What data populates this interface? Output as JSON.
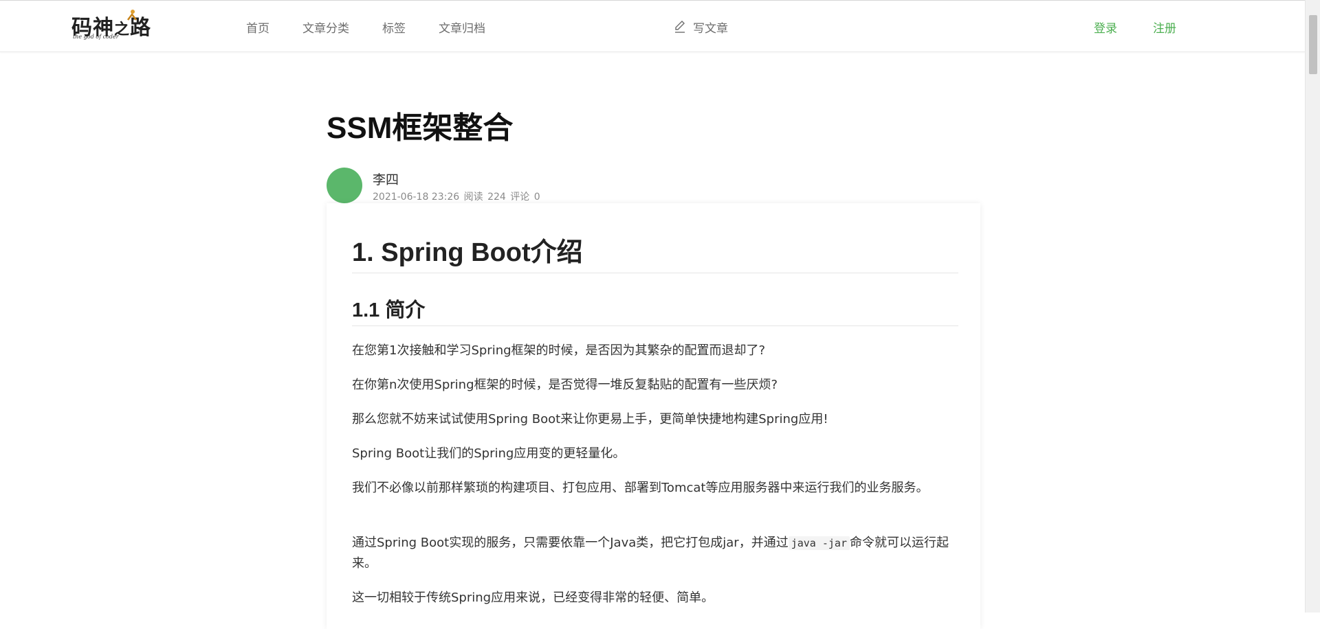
{
  "header": {
    "logo_text_main_1": "码神",
    "logo_text_zhi": "之",
    "logo_text_main_2": "路",
    "logo_subtitle": "the god of coder",
    "nav": [
      {
        "label": "首页"
      },
      {
        "label": "文章分类"
      },
      {
        "label": "标签"
      },
      {
        "label": "文章归档"
      }
    ],
    "write_label": "写文章",
    "login_label": "登录",
    "register_label": "注册",
    "accent_color": "#4caf50"
  },
  "article": {
    "title": "SSM框架整合",
    "author": {
      "name": "李四",
      "date": "2021-06-18 23:26",
      "reads_label": "阅读",
      "reads": "224",
      "comments_label": "评论",
      "comments": "0",
      "avatar_color": "#5bb76b"
    },
    "content": {
      "h1": "1. Spring Boot介绍",
      "h2": "1.1 简介",
      "paragraphs": [
        "在您第1次接触和学习Spring框架的时候，是否因为其繁杂的配置而退却了?",
        "在你第n次使用Spring框架的时候，是否觉得一堆反复黏贴的配置有一些厌烦?",
        "那么您就不妨来试试使用Spring Boot来让你更易上手，更简单快捷地构建Spring应用!",
        "Spring Boot让我们的Spring应用变的更轻量化。",
        "我们不必像以前那样繁琐的构建项目、打包应用、部署到Tomcat等应用服务器中来运行我们的业务服务。"
      ],
      "p6_before": "通过Spring Boot实现的服务，只需要依靠一个Java类，把它打包成jar，并通过",
      "p6_code": "java -jar",
      "p6_after": "命令就可以运行起来。",
      "p7": "这一切相较于传统Spring应用来说，已经变得非常的轻便、简单。"
    }
  }
}
